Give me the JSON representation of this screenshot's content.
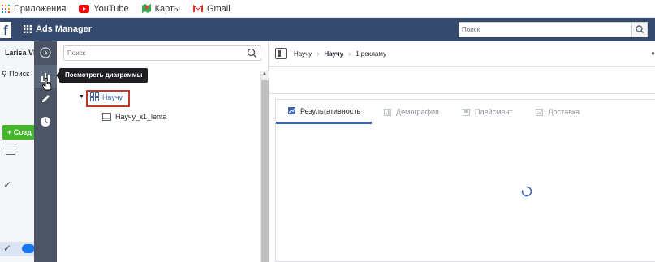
{
  "bookmarks": [
    {
      "label": "Приложения",
      "icon": "apps-grid-icon"
    },
    {
      "label": "YouTube",
      "icon": "youtube-icon"
    },
    {
      "label": "Карты",
      "icon": "maps-icon"
    },
    {
      "label": "Gmail",
      "icon": "gmail-icon"
    }
  ],
  "topnav": {
    "logo": "f",
    "app_title": "Ads Manager",
    "search_placeholder": "Поиск"
  },
  "under_page": {
    "account_name": "Larisa Vla",
    "search_label": "Поиск",
    "create_label": "+ Созд"
  },
  "toolbar": {
    "tooltip": "Посмотреть диаграммы"
  },
  "tree": {
    "search_placeholder": "Поиск",
    "campaign_label": "Научу",
    "adset_label": "Научу_к1_lenta"
  },
  "main": {
    "breadcrumbs": [
      "Научу",
      "Научу",
      "1 рекламу"
    ],
    "tabs": [
      {
        "label": "Результативность",
        "active": true
      },
      {
        "label": "Демография",
        "active": false
      },
      {
        "label": "Плейсмент",
        "active": false
      },
      {
        "label": "Доставка",
        "active": false
      }
    ]
  },
  "colors": {
    "nav": "#364a6e",
    "toolbar": "#4b5565",
    "accent": "#4267b2",
    "create_green": "#42b72a",
    "highlight_red": "#c0392b"
  }
}
